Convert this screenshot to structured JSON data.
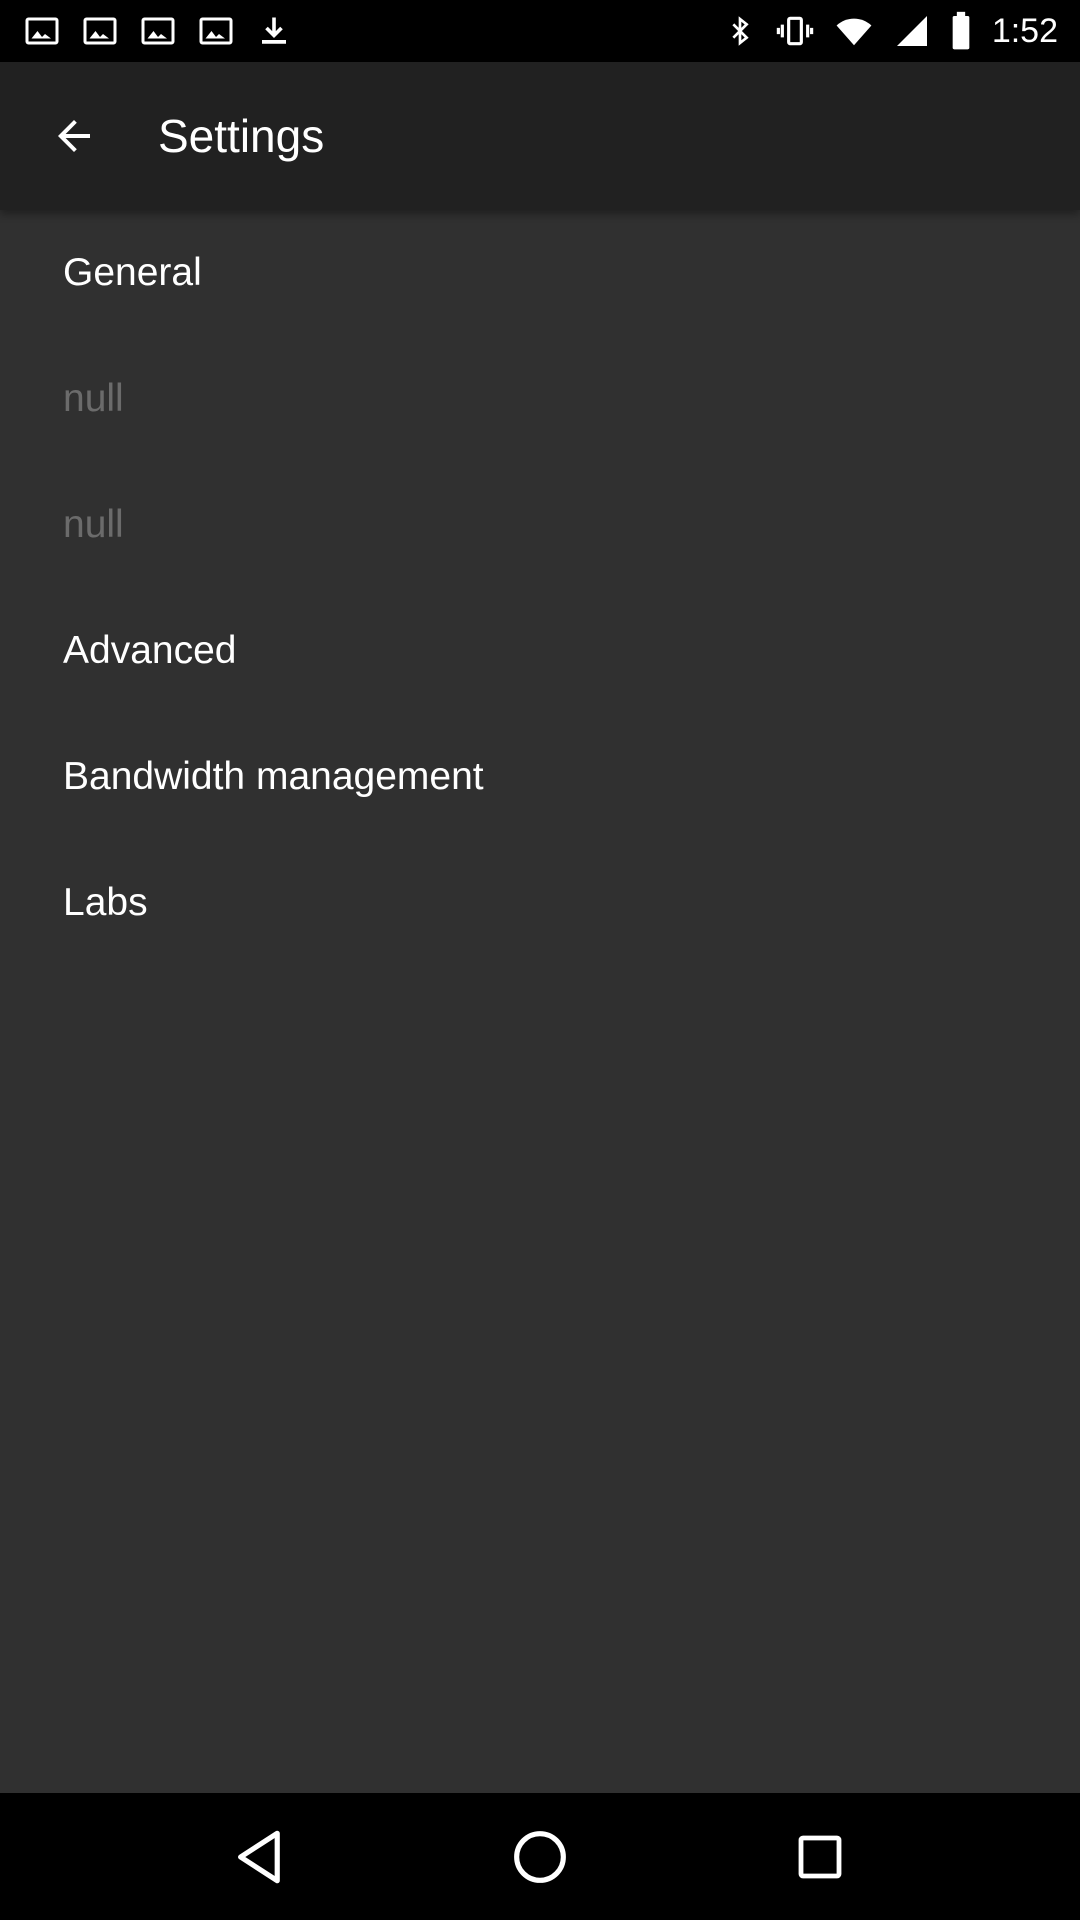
{
  "status_bar": {
    "time": "1:52",
    "icons": [
      "image-icon",
      "image-icon",
      "image-icon",
      "image-icon",
      "download-icon",
      "bluetooth-icon",
      "vibrate-icon",
      "wifi-icon",
      "cellular-icon",
      "battery-icon"
    ]
  },
  "app_bar": {
    "title": "Settings",
    "back_icon": "arrow-back-icon"
  },
  "settings": {
    "items": [
      {
        "label": "General",
        "enabled": true
      },
      {
        "label": "null",
        "enabled": false
      },
      {
        "label": "null",
        "enabled": false
      },
      {
        "label": "Advanced",
        "enabled": true
      },
      {
        "label": "Bandwidth management",
        "enabled": true
      },
      {
        "label": "Labs",
        "enabled": true
      }
    ]
  },
  "nav_bar": {
    "icons": [
      "back-triangle-icon",
      "home-circle-icon",
      "recents-square-icon"
    ]
  },
  "colors": {
    "status_bar": "#000000",
    "app_bar": "#212121",
    "background": "#303030",
    "text_primary": "#ffffff",
    "text_disabled": "#6b6b6b"
  }
}
